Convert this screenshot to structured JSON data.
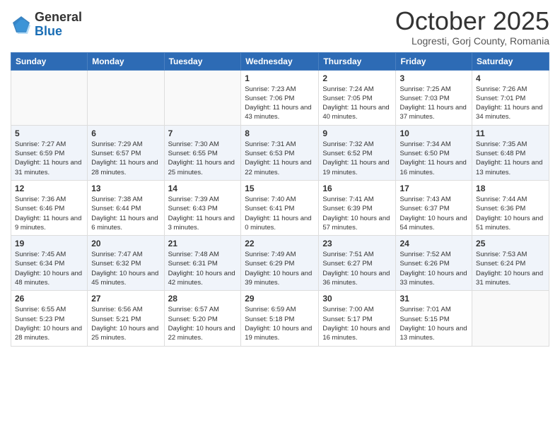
{
  "header": {
    "logo_general": "General",
    "logo_blue": "Blue",
    "month_title": "October 2025",
    "subtitle": "Logresti, Gorj County, Romania"
  },
  "weekdays": [
    "Sunday",
    "Monday",
    "Tuesday",
    "Wednesday",
    "Thursday",
    "Friday",
    "Saturday"
  ],
  "weeks": [
    [
      {
        "day": "",
        "sunrise": "",
        "sunset": "",
        "daylight": ""
      },
      {
        "day": "",
        "sunrise": "",
        "sunset": "",
        "daylight": ""
      },
      {
        "day": "",
        "sunrise": "",
        "sunset": "",
        "daylight": ""
      },
      {
        "day": "1",
        "sunrise": "Sunrise: 7:23 AM",
        "sunset": "Sunset: 7:06 PM",
        "daylight": "Daylight: 11 hours and 43 minutes."
      },
      {
        "day": "2",
        "sunrise": "Sunrise: 7:24 AM",
        "sunset": "Sunset: 7:05 PM",
        "daylight": "Daylight: 11 hours and 40 minutes."
      },
      {
        "day": "3",
        "sunrise": "Sunrise: 7:25 AM",
        "sunset": "Sunset: 7:03 PM",
        "daylight": "Daylight: 11 hours and 37 minutes."
      },
      {
        "day": "4",
        "sunrise": "Sunrise: 7:26 AM",
        "sunset": "Sunset: 7:01 PM",
        "daylight": "Daylight: 11 hours and 34 minutes."
      }
    ],
    [
      {
        "day": "5",
        "sunrise": "Sunrise: 7:27 AM",
        "sunset": "Sunset: 6:59 PM",
        "daylight": "Daylight: 11 hours and 31 minutes."
      },
      {
        "day": "6",
        "sunrise": "Sunrise: 7:29 AM",
        "sunset": "Sunset: 6:57 PM",
        "daylight": "Daylight: 11 hours and 28 minutes."
      },
      {
        "day": "7",
        "sunrise": "Sunrise: 7:30 AM",
        "sunset": "Sunset: 6:55 PM",
        "daylight": "Daylight: 11 hours and 25 minutes."
      },
      {
        "day": "8",
        "sunrise": "Sunrise: 7:31 AM",
        "sunset": "Sunset: 6:53 PM",
        "daylight": "Daylight: 11 hours and 22 minutes."
      },
      {
        "day": "9",
        "sunrise": "Sunrise: 7:32 AM",
        "sunset": "Sunset: 6:52 PM",
        "daylight": "Daylight: 11 hours and 19 minutes."
      },
      {
        "day": "10",
        "sunrise": "Sunrise: 7:34 AM",
        "sunset": "Sunset: 6:50 PM",
        "daylight": "Daylight: 11 hours and 16 minutes."
      },
      {
        "day": "11",
        "sunrise": "Sunrise: 7:35 AM",
        "sunset": "Sunset: 6:48 PM",
        "daylight": "Daylight: 11 hours and 13 minutes."
      }
    ],
    [
      {
        "day": "12",
        "sunrise": "Sunrise: 7:36 AM",
        "sunset": "Sunset: 6:46 PM",
        "daylight": "Daylight: 11 hours and 9 minutes."
      },
      {
        "day": "13",
        "sunrise": "Sunrise: 7:38 AM",
        "sunset": "Sunset: 6:44 PM",
        "daylight": "Daylight: 11 hours and 6 minutes."
      },
      {
        "day": "14",
        "sunrise": "Sunrise: 7:39 AM",
        "sunset": "Sunset: 6:43 PM",
        "daylight": "Daylight: 11 hours and 3 minutes."
      },
      {
        "day": "15",
        "sunrise": "Sunrise: 7:40 AM",
        "sunset": "Sunset: 6:41 PM",
        "daylight": "Daylight: 11 hours and 0 minutes."
      },
      {
        "day": "16",
        "sunrise": "Sunrise: 7:41 AM",
        "sunset": "Sunset: 6:39 PM",
        "daylight": "Daylight: 10 hours and 57 minutes."
      },
      {
        "day": "17",
        "sunrise": "Sunrise: 7:43 AM",
        "sunset": "Sunset: 6:37 PM",
        "daylight": "Daylight: 10 hours and 54 minutes."
      },
      {
        "day": "18",
        "sunrise": "Sunrise: 7:44 AM",
        "sunset": "Sunset: 6:36 PM",
        "daylight": "Daylight: 10 hours and 51 minutes."
      }
    ],
    [
      {
        "day": "19",
        "sunrise": "Sunrise: 7:45 AM",
        "sunset": "Sunset: 6:34 PM",
        "daylight": "Daylight: 10 hours and 48 minutes."
      },
      {
        "day": "20",
        "sunrise": "Sunrise: 7:47 AM",
        "sunset": "Sunset: 6:32 PM",
        "daylight": "Daylight: 10 hours and 45 minutes."
      },
      {
        "day": "21",
        "sunrise": "Sunrise: 7:48 AM",
        "sunset": "Sunset: 6:31 PM",
        "daylight": "Daylight: 10 hours and 42 minutes."
      },
      {
        "day": "22",
        "sunrise": "Sunrise: 7:49 AM",
        "sunset": "Sunset: 6:29 PM",
        "daylight": "Daylight: 10 hours and 39 minutes."
      },
      {
        "day": "23",
        "sunrise": "Sunrise: 7:51 AM",
        "sunset": "Sunset: 6:27 PM",
        "daylight": "Daylight: 10 hours and 36 minutes."
      },
      {
        "day": "24",
        "sunrise": "Sunrise: 7:52 AM",
        "sunset": "Sunset: 6:26 PM",
        "daylight": "Daylight: 10 hours and 33 minutes."
      },
      {
        "day": "25",
        "sunrise": "Sunrise: 7:53 AM",
        "sunset": "Sunset: 6:24 PM",
        "daylight": "Daylight: 10 hours and 31 minutes."
      }
    ],
    [
      {
        "day": "26",
        "sunrise": "Sunrise: 6:55 AM",
        "sunset": "Sunset: 5:23 PM",
        "daylight": "Daylight: 10 hours and 28 minutes."
      },
      {
        "day": "27",
        "sunrise": "Sunrise: 6:56 AM",
        "sunset": "Sunset: 5:21 PM",
        "daylight": "Daylight: 10 hours and 25 minutes."
      },
      {
        "day": "28",
        "sunrise": "Sunrise: 6:57 AM",
        "sunset": "Sunset: 5:20 PM",
        "daylight": "Daylight: 10 hours and 22 minutes."
      },
      {
        "day": "29",
        "sunrise": "Sunrise: 6:59 AM",
        "sunset": "Sunset: 5:18 PM",
        "daylight": "Daylight: 10 hours and 19 minutes."
      },
      {
        "day": "30",
        "sunrise": "Sunrise: 7:00 AM",
        "sunset": "Sunset: 5:17 PM",
        "daylight": "Daylight: 10 hours and 16 minutes."
      },
      {
        "day": "31",
        "sunrise": "Sunrise: 7:01 AM",
        "sunset": "Sunset: 5:15 PM",
        "daylight": "Daylight: 10 hours and 13 minutes."
      },
      {
        "day": "",
        "sunrise": "",
        "sunset": "",
        "daylight": ""
      }
    ]
  ]
}
